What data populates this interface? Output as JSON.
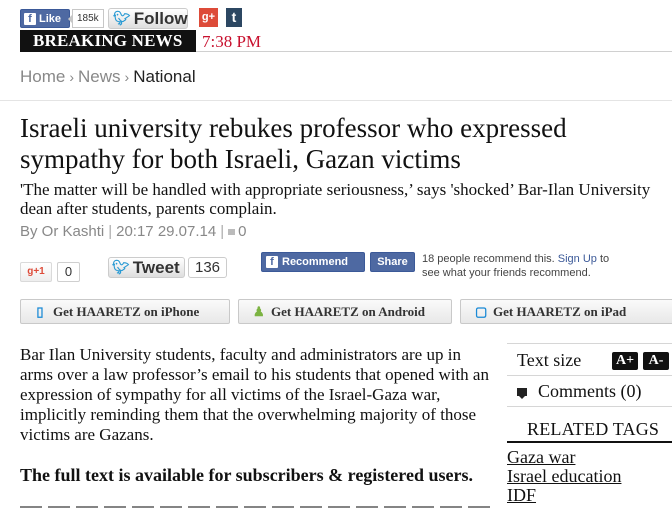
{
  "social": {
    "fb_like_label": "Like",
    "fb_like_count": "185k",
    "tw_follow_label": "Follow",
    "gplus_label": "g+",
    "tumblr_label": "t"
  },
  "breaking": {
    "label": "BREAKING NEWS",
    "time": "7:38 PM"
  },
  "breadcrumb": {
    "items": [
      "Home",
      "News",
      "National"
    ]
  },
  "article": {
    "headline": "Israeli university rebukes professor who expressed sympathy for both Israeli, Gazan victims",
    "subhead": "'The matter will be handled with appropriate seriousness,’ says 'shocked’ Bar-Ilan University dean after students, parents complain.",
    "author": "By Or Kashti",
    "datetime": "20:17 29.07.14",
    "comment_count": "0",
    "body": "Bar Ilan University students, faculty and administrators are up in arms over a law professor’s email to his students that opened with an expression of sympathy for all victims of the Israel-Gaza war, implicitly reminding them that the overwhelming majority of those victims are Gazans.",
    "paywall_notice": "The full text is available for subscribers & registered users."
  },
  "share": {
    "gplus_label": "g+1",
    "gplus_count": "0",
    "tweet_label": "Tweet",
    "tweet_count": "136",
    "fb_recommend_label": "Recommend",
    "fb_share_label": "Share",
    "fb_text_prefix": "18 people recommend this.",
    "fb_signup_link": "Sign Up",
    "fb_text_suffix": "to see what your friends recommend."
  },
  "apps": {
    "iphone": "Get HAARETZ on iPhone",
    "android": "Get HAARETZ on Android",
    "ipad": "Get HAARETZ on iPad"
  },
  "sidebar": {
    "text_size_label": "Text size",
    "size_up": "A+",
    "size_down": "A-",
    "comments_label": "Comments (0)",
    "related_title": "RELATED TAGS",
    "tags": [
      "Gaza war",
      "Israel education",
      "IDF"
    ]
  },
  "colors": {
    "breaking_red": "#c8102e",
    "facebook_blue": "#4e69a2",
    "twitter_blue": "#2b9bd4",
    "gplus_red": "#dd4b39"
  }
}
